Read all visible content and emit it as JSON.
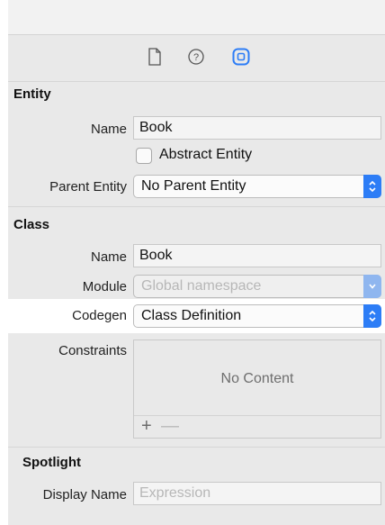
{
  "colors": {
    "accent": "#2d7df6",
    "panel": "#e9e9e9"
  },
  "toolbar": {
    "tabs": [
      {
        "icon": "file-icon"
      },
      {
        "icon": "help-icon"
      },
      {
        "icon": "data-model-inspector-icon",
        "selected": true
      }
    ]
  },
  "entity": {
    "title": "Entity",
    "name_label": "Name",
    "name_value": "Book",
    "abstract_label": "Abstract Entity",
    "abstract_checked": false,
    "parent_label": "Parent Entity",
    "parent_value": "No Parent Entity"
  },
  "class": {
    "title": "Class",
    "name_label": "Name",
    "name_value": "Book",
    "module_label": "Module",
    "module_placeholder": "Global namespace",
    "codegen_label": "Codegen",
    "codegen_value": "Class Definition"
  },
  "constraints": {
    "label": "Constraints",
    "empty_text": "No Content",
    "add": "+",
    "remove": "—"
  },
  "spotlight": {
    "title": "Spotlight",
    "display_name_label": "Display Name",
    "display_name_placeholder": "Expression"
  }
}
